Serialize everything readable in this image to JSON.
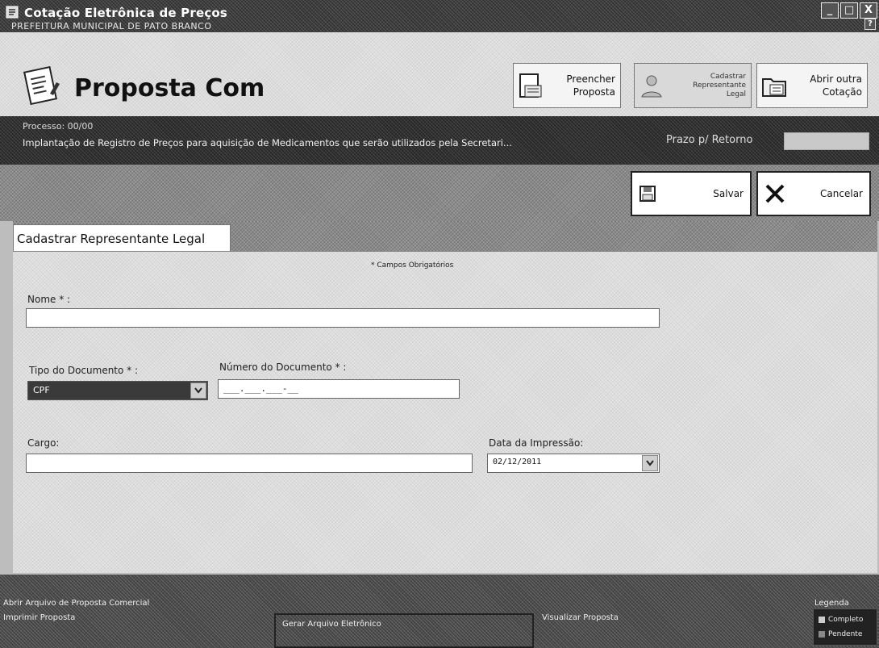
{
  "window": {
    "title": "Cotação Eletrônica de Preços",
    "subtitle": "PREFEITURA MUNICIPAL DE PATO BRANCO",
    "controls": {
      "minimize": "_",
      "maximize": "□",
      "close": "X",
      "help": "?"
    }
  },
  "header": {
    "app_name": "Proposta Com",
    "buttons": {
      "preencher": "Preencher\nProposta",
      "cadastrar": "Cadastrar\nRepresentante\nLegal",
      "abrir": "Abrir outra\nCotação"
    }
  },
  "info": {
    "processo": "Processo: 00/00",
    "objeto": "Implantação de Registro de Preços para aquisição de Medicamentos que serão utilizados pela Secretari...",
    "prazo_label": "Prazo p/ Retorno",
    "prazo_value": ""
  },
  "actions": {
    "save_label": "Salvar",
    "cancel_label": "Cancelar"
  },
  "form": {
    "tab_label": "Cadastrar Representante Legal",
    "required_note": "* Campos Obrigatórios",
    "nome_label": "Nome * :",
    "nome_value": "",
    "tipo_label": "Tipo do Documento * :",
    "tipo_value": "CPF",
    "numero_label": "Número do Documento * :",
    "numero_value": "___.___.___-__",
    "cargo_label": "Cargo:",
    "cargo_value": "",
    "data_label": "Data da Impressão:",
    "data_value": "02/12/2011"
  },
  "bottom": {
    "left1": "Abrir Arquivo de Proposta Comercial",
    "left2": "Imprimir Proposta",
    "center": "Gerar Arquivo Eletrônico",
    "right": "Visualizar Proposta",
    "legend_title": "Legenda",
    "legend": [
      "Completo",
      "Pendente"
    ]
  }
}
